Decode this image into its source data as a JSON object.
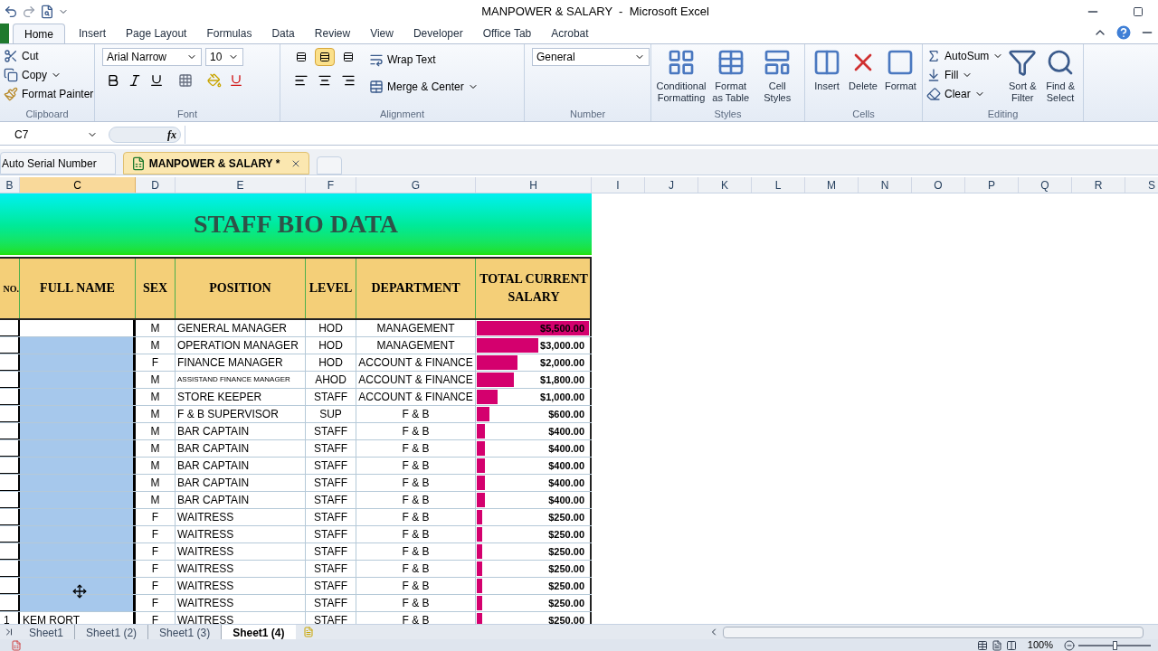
{
  "window": {
    "title": "MANPOWER & SALARY  -  Microsoft Excel"
  },
  "ribbon_tabs": [
    {
      "label": "Home",
      "selected": true
    },
    {
      "label": "Insert",
      "selected": false
    },
    {
      "label": "Page Layout",
      "selected": false
    },
    {
      "label": "Formulas",
      "selected": false
    },
    {
      "label": "Data",
      "selected": false
    },
    {
      "label": "Review",
      "selected": false
    },
    {
      "label": "View",
      "selected": false
    },
    {
      "label": "Developer",
      "selected": false
    },
    {
      "label": "Office Tab",
      "selected": false
    },
    {
      "label": "Acrobat",
      "selected": false
    }
  ],
  "clipboard": {
    "label": "Clipboard",
    "cut": "Cut",
    "copy": "Copy",
    "painter": "Format Painter"
  },
  "font": {
    "label": "Font",
    "family": "Arial Narrow",
    "size": "10"
  },
  "alignment": {
    "label": "Alignment",
    "vertical": [
      {
        "selected": false
      },
      {
        "selected": true
      },
      {
        "selected": false
      }
    ],
    "wrap": "Wrap Text",
    "merge": "Merge & Center"
  },
  "number": {
    "label": "Number",
    "format": "General"
  },
  "styles": {
    "label": "Styles",
    "buttons": [
      "Conditional Formatting",
      "Format as Table",
      "Cell Styles"
    ]
  },
  "cells": {
    "label": "Cells",
    "buttons": [
      "Insert",
      "Delete",
      "Format"
    ]
  },
  "editing": {
    "label": "Editing",
    "small": [
      "AutoSum",
      "Fill",
      "Clear"
    ],
    "large": [
      "Sort & Filter",
      "Find & Select"
    ]
  },
  "formula_bar": {
    "name_box": "C7",
    "fx": "fx"
  },
  "workbook_tabs": [
    {
      "label": "Auto Serial Number",
      "selected": false
    },
    {
      "label": "MANPOWER & SALARY *",
      "selected": true
    }
  ],
  "column_headers": [
    {
      "label": "B",
      "selected": false
    },
    {
      "label": "C",
      "selected": true
    },
    {
      "label": "D",
      "selected": false
    },
    {
      "label": "E",
      "selected": false
    },
    {
      "label": "F",
      "selected": false
    },
    {
      "label": "G",
      "selected": false
    },
    {
      "label": "H",
      "selected": false
    },
    {
      "label": "I",
      "selected": false
    },
    {
      "label": "J",
      "selected": false
    },
    {
      "label": "K",
      "selected": false
    },
    {
      "label": "L",
      "selected": false
    },
    {
      "label": "M",
      "selected": false
    },
    {
      "label": "N",
      "selected": false
    },
    {
      "label": "O",
      "selected": false
    },
    {
      "label": "P",
      "selected": false
    },
    {
      "label": "Q",
      "selected": false
    },
    {
      "label": "R",
      "selected": false
    },
    {
      "label": "S",
      "selected": false
    }
  ],
  "sheet": {
    "title": "STAFF BIO DATA",
    "headers": [
      "NO.",
      "FULL NAME",
      "SEX",
      "POSITION",
      "LEVEL",
      "DEPARTMENT",
      "TOTAL CURRENT SALARY"
    ],
    "rows": [
      {
        "selected": false,
        "sex": "M",
        "position": "GENERAL MANAGER",
        "condensed": false,
        "grade": "HOD",
        "department": "MANAGEMENT",
        "salary": "$5,500.00",
        "level": 1
      },
      {
        "selected": true,
        "sex": "M",
        "position": "OPERATION MANAGER",
        "condensed": false,
        "grade": "HOD",
        "department": "MANAGEMENT",
        "salary": "$3,000.00",
        "level": 0.545
      },
      {
        "selected": true,
        "sex": "F",
        "position": "FINANCE MANAGER",
        "condensed": false,
        "grade": "HOD",
        "department": "ACCOUNT & FINANCE",
        "salary": "$2,000.00",
        "level": 0.364
      },
      {
        "selected": true,
        "sex": "M",
        "position": "ASSISTAND FINANCE MANAGER",
        "condensed": true,
        "grade": "AHOD",
        "department": "ACCOUNT & FINANCE",
        "salary": "$1,800.00",
        "level": 0.327
      },
      {
        "selected": true,
        "sex": "M",
        "position": "STORE KEEPER",
        "condensed": false,
        "grade": "STAFF",
        "department": "ACCOUNT & FINANCE",
        "salary": "$1,000.00",
        "level": 0.182
      },
      {
        "selected": true,
        "sex": "M",
        "position": "F & B SUPERVISOR",
        "condensed": false,
        "grade": "SUP",
        "department": "F & B",
        "salary": "$600.00",
        "level": 0.109
      },
      {
        "selected": true,
        "sex": "M",
        "position": "BAR CAPTAIN",
        "condensed": false,
        "grade": "STAFF",
        "department": "F & B",
        "salary": "$400.00",
        "level": 0.073
      },
      {
        "selected": true,
        "sex": "M",
        "position": "BAR CAPTAIN",
        "condensed": false,
        "grade": "STAFF",
        "department": "F & B",
        "salary": "$400.00",
        "level": 0.073
      },
      {
        "selected": true,
        "sex": "M",
        "position": "BAR CAPTAIN",
        "condensed": false,
        "grade": "STAFF",
        "department": "F & B",
        "salary": "$400.00",
        "level": 0.073
      },
      {
        "selected": true,
        "sex": "M",
        "position": "BAR CAPTAIN",
        "condensed": false,
        "grade": "STAFF",
        "department": "F & B",
        "salary": "$400.00",
        "level": 0.073
      },
      {
        "selected": true,
        "sex": "M",
        "position": "BAR CAPTAIN",
        "condensed": false,
        "grade": "STAFF",
        "department": "F & B",
        "salary": "$400.00",
        "level": 0.073
      },
      {
        "selected": true,
        "sex": "F",
        "position": "WAITRESS",
        "condensed": false,
        "grade": "STAFF",
        "department": "F & B",
        "salary": "$250.00",
        "level": 0.045
      },
      {
        "selected": true,
        "sex": "F",
        "position": "WAITRESS",
        "condensed": false,
        "grade": "STAFF",
        "department": "F & B",
        "salary": "$250.00",
        "level": 0.045
      },
      {
        "selected": true,
        "sex": "F",
        "position": "WAITRESS",
        "condensed": false,
        "grade": "STAFF",
        "department": "F & B",
        "salary": "$250.00",
        "level": 0.045
      },
      {
        "selected": true,
        "sex": "F",
        "position": "WAITRESS",
        "condensed": false,
        "grade": "STAFF",
        "department": "F & B",
        "salary": "$250.00",
        "level": 0.045
      },
      {
        "selected": true,
        "sex": "F",
        "position": "WAITRESS",
        "condensed": false,
        "grade": "STAFF",
        "department": "F & B",
        "salary": "$250.00",
        "level": 0.045
      },
      {
        "selected": true,
        "sex": "F",
        "position": "WAITRESS",
        "condensed": false,
        "grade": "STAFF",
        "department": "F & B",
        "salary": "$250.00",
        "level": 0.045
      },
      {
        "no": "1",
        "name": "KEM RORT",
        "selected": false,
        "sex": "F",
        "position": "WAITRESS",
        "condensed": false,
        "grade": "STAFF",
        "department": "F & B",
        "salary": "$250.00",
        "level": 0.045
      }
    ]
  },
  "sheet_tabs": [
    {
      "label": "Sheet1",
      "selected": false
    },
    {
      "label": "Sheet1 (2)",
      "selected": false
    },
    {
      "label": "Sheet1 (3)",
      "selected": false
    },
    {
      "label": "Sheet1 (4)",
      "selected": true
    }
  ],
  "status_bar": {
    "zoom": "100%",
    "zoom_slider": {
      "level": 0.5
    }
  }
}
